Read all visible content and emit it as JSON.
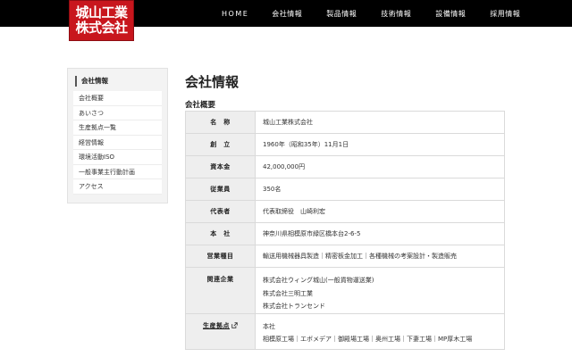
{
  "header": {
    "logo_line1": "城山工業",
    "logo_line2": "株式会社",
    "nav": [
      "HOME",
      "会社情報",
      "製品情報",
      "技術情報",
      "設備情報",
      "採用情報"
    ]
  },
  "sidebar": {
    "heading": "会社情報",
    "items": [
      "会社概要",
      "あいさつ",
      "生産拠点一覧",
      "経営情報",
      "環境活動ISO",
      "一般事業主行動計画",
      "アクセス"
    ]
  },
  "main": {
    "title": "会社情報",
    "section": "会社概要",
    "rows": [
      {
        "label": "名　称",
        "lines": [
          "城山工業株式会社"
        ]
      },
      {
        "label": "創　立",
        "lines": [
          "1960年（昭和35年）11月1日"
        ]
      },
      {
        "label": "資本金",
        "lines": [
          "42,000,000円"
        ]
      },
      {
        "label": "従業員",
        "lines": [
          "350名"
        ]
      },
      {
        "label": "代表者",
        "lines": [
          "代表取締役　山崎利宏"
        ]
      },
      {
        "label": "本　社",
        "lines": [
          "神奈川県相模原市緑区橋本台2-6-5"
        ]
      },
      {
        "label": "営業種目",
        "lines": [
          "輸送用機械器具製造｜精密板金加工｜各種機械の考案設計・製造販売"
        ]
      },
      {
        "label": "関連企業",
        "lines": [
          "株式会社ウィング城山(一般貨物運送業)",
          "株式会社三明工業",
          "株式会社トランセンド"
        ]
      },
      {
        "label": "生産拠点",
        "lines": [
          "本社",
          "相模原工場｜エボメデア｜御殿場工場｜奥州工場｜下妻工場｜MP厚木工場"
        ]
      }
    ]
  }
}
